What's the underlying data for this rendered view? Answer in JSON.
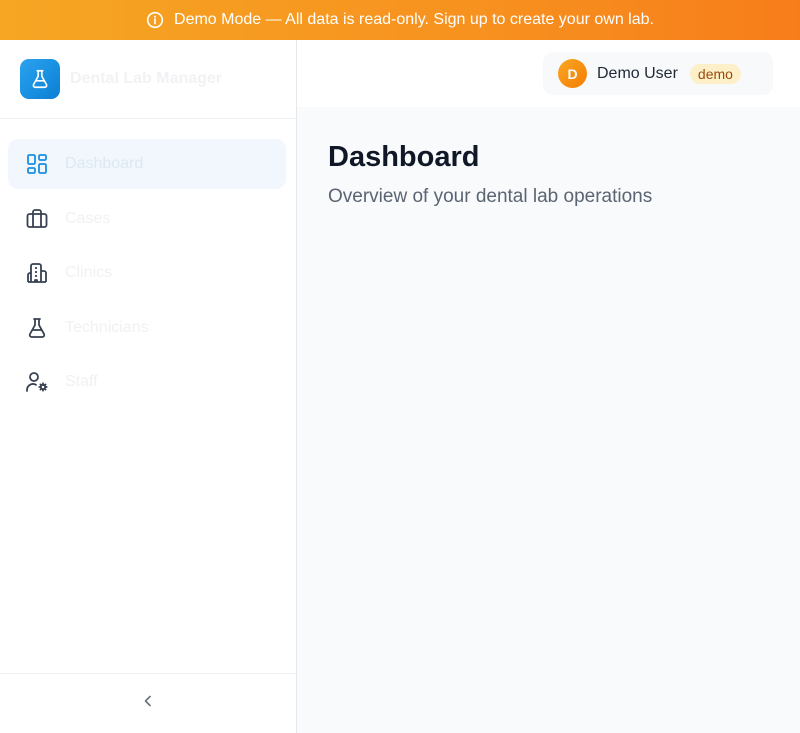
{
  "banner": {
    "text": "Demo Mode — All data is read-only. Sign up to create your own lab.",
    "icon": "info-icon"
  },
  "brand": {
    "name": "Dental Lab Manager",
    "logo_icon": "flask-icon",
    "accent": "#1a8fe0"
  },
  "sidebar": {
    "items": [
      {
        "label": "Dashboard",
        "icon": "dashboard-icon",
        "active": true
      },
      {
        "label": "Cases",
        "icon": "briefcase-icon",
        "active": false
      },
      {
        "label": "Clinics",
        "icon": "building-icon",
        "active": false
      },
      {
        "label": "Technicians",
        "icon": "flask-icon",
        "active": false
      },
      {
        "label": "Staff",
        "icon": "user-cog-icon",
        "active": false
      }
    ],
    "collapse_icon": "chevron-left-icon"
  },
  "user": {
    "initial": "D",
    "name": "Demo User",
    "role": "demo"
  },
  "main": {
    "title": "Dashboard",
    "subtitle": "Overview of your dental lab operations"
  },
  "colors": {
    "banner": "#f7911f",
    "active_nav_bg": "#f1f7fd",
    "avatar": "#f57c00",
    "role_badge_bg": "#fdf0c8"
  }
}
